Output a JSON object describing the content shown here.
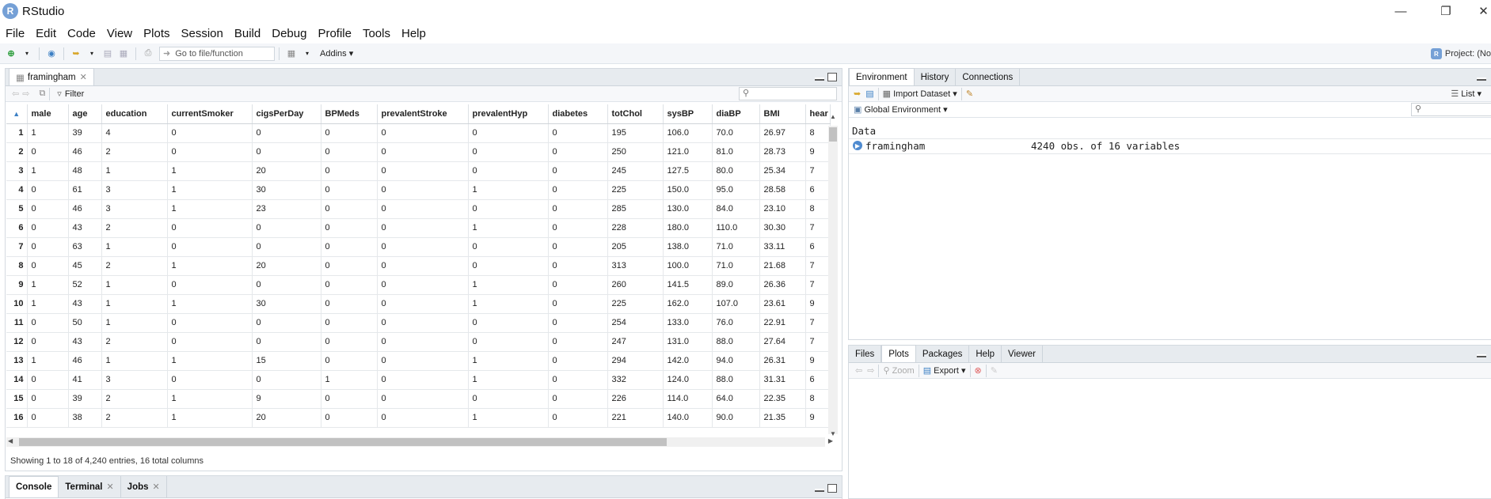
{
  "app": {
    "title": "RStudio",
    "logo_letter": "R"
  },
  "menu": [
    "File",
    "Edit",
    "Code",
    "View",
    "Plots",
    "Session",
    "Build",
    "Debug",
    "Profile",
    "Tools",
    "Help"
  ],
  "toolbar": {
    "goto_placeholder": "Go to file/function",
    "addins_label": "Addins",
    "project_label": "Project: (No"
  },
  "source": {
    "tab_label": "framingham",
    "filter_label": "Filter",
    "columns": [
      "male",
      "age",
      "education",
      "currentSmoker",
      "cigsPerDay",
      "BPMeds",
      "prevalentStroke",
      "prevalentHyp",
      "diabetes",
      "totChol",
      "sysBP",
      "diaBP",
      "BMI",
      "hear"
    ],
    "rows": [
      [
        "1",
        "1",
        "39",
        "4",
        "0",
        "0",
        "0",
        "0",
        "0",
        "0",
        "195",
        "106.0",
        "70.0",
        "26.97",
        "8"
      ],
      [
        "2",
        "0",
        "46",
        "2",
        "0",
        "0",
        "0",
        "0",
        "0",
        "0",
        "250",
        "121.0",
        "81.0",
        "28.73",
        "9"
      ],
      [
        "3",
        "1",
        "48",
        "1",
        "1",
        "20",
        "0",
        "0",
        "0",
        "0",
        "245",
        "127.5",
        "80.0",
        "25.34",
        "7"
      ],
      [
        "4",
        "0",
        "61",
        "3",
        "1",
        "30",
        "0",
        "0",
        "1",
        "0",
        "225",
        "150.0",
        "95.0",
        "28.58",
        "6"
      ],
      [
        "5",
        "0",
        "46",
        "3",
        "1",
        "23",
        "0",
        "0",
        "0",
        "0",
        "285",
        "130.0",
        "84.0",
        "23.10",
        "8"
      ],
      [
        "6",
        "0",
        "43",
        "2",
        "0",
        "0",
        "0",
        "0",
        "1",
        "0",
        "228",
        "180.0",
        "110.0",
        "30.30",
        "7"
      ],
      [
        "7",
        "0",
        "63",
        "1",
        "0",
        "0",
        "0",
        "0",
        "0",
        "0",
        "205",
        "138.0",
        "71.0",
        "33.11",
        "6"
      ],
      [
        "8",
        "0",
        "45",
        "2",
        "1",
        "20",
        "0",
        "0",
        "0",
        "0",
        "313",
        "100.0",
        "71.0",
        "21.68",
        "7"
      ],
      [
        "9",
        "1",
        "52",
        "1",
        "0",
        "0",
        "0",
        "0",
        "1",
        "0",
        "260",
        "141.5",
        "89.0",
        "26.36",
        "7"
      ],
      [
        "10",
        "1",
        "43",
        "1",
        "1",
        "30",
        "0",
        "0",
        "1",
        "0",
        "225",
        "162.0",
        "107.0",
        "23.61",
        "9"
      ],
      [
        "11",
        "0",
        "50",
        "1",
        "0",
        "0",
        "0",
        "0",
        "0",
        "0",
        "254",
        "133.0",
        "76.0",
        "22.91",
        "7"
      ],
      [
        "12",
        "0",
        "43",
        "2",
        "0",
        "0",
        "0",
        "0",
        "0",
        "0",
        "247",
        "131.0",
        "88.0",
        "27.64",
        "7"
      ],
      [
        "13",
        "1",
        "46",
        "1",
        "1",
        "15",
        "0",
        "0",
        "1",
        "0",
        "294",
        "142.0",
        "94.0",
        "26.31",
        "9"
      ],
      [
        "14",
        "0",
        "41",
        "3",
        "0",
        "0",
        "1",
        "0",
        "1",
        "0",
        "332",
        "124.0",
        "88.0",
        "31.31",
        "6"
      ],
      [
        "15",
        "0",
        "39",
        "2",
        "1",
        "9",
        "0",
        "0",
        "0",
        "0",
        "226",
        "114.0",
        "64.0",
        "22.35",
        "8"
      ],
      [
        "16",
        "0",
        "38",
        "2",
        "1",
        "20",
        "0",
        "0",
        "1",
        "0",
        "221",
        "140.0",
        "90.0",
        "21.35",
        "9"
      ]
    ],
    "status": "Showing 1 to 18 of 4,240 entries, 16 total columns"
  },
  "console": {
    "tabs": [
      "Console",
      "Terminal",
      "Jobs"
    ]
  },
  "env": {
    "tabs": [
      "Environment",
      "History",
      "Connections"
    ],
    "import_label": "Import Dataset",
    "list_label": "List",
    "scope_label": "Global Environment",
    "section": "Data",
    "objects": [
      {
        "name": "framingham",
        "value": "4240 obs. of 16 variables"
      }
    ]
  },
  "files": {
    "tabs": [
      "Files",
      "Plots",
      "Packages",
      "Help",
      "Viewer"
    ],
    "zoom_label": "Zoom",
    "export_label": "Export"
  },
  "colors": {
    "accent": "#75a0d6",
    "chrome": "#e7ebef"
  }
}
